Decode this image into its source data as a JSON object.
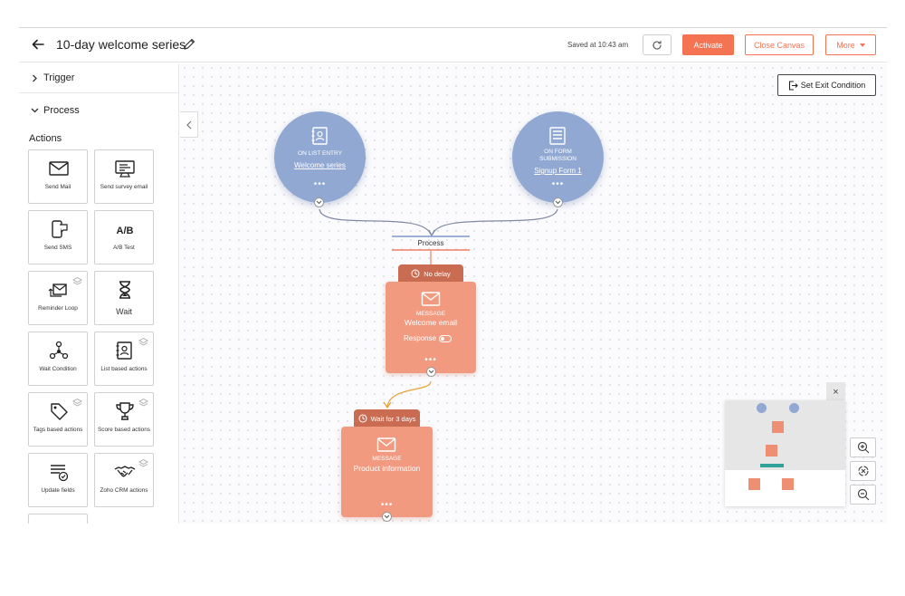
{
  "header": {
    "title": "10-day welcome series",
    "saved_text": "Saved at 10:43 am",
    "activate_label": "Activate",
    "close_canvas_label": "Close Canvas",
    "more_label": "More"
  },
  "sidebar": {
    "trigger_label": "Trigger",
    "process_label": "Process",
    "actions_title": "Actions",
    "actions": [
      {
        "label": "Send Mail",
        "icon": "mail-icon"
      },
      {
        "label": "Send survey email",
        "icon": "survey-icon"
      },
      {
        "label": "Send SMS",
        "icon": "sms-icon"
      },
      {
        "label": "A/B Test",
        "icon": "ab-test-icon"
      },
      {
        "label": "Reminder Loop",
        "icon": "reminder-loop-icon"
      },
      {
        "label": "Wait",
        "icon": "hourglass-icon"
      },
      {
        "label": "Wait Condition",
        "icon": "wait-condition-icon"
      },
      {
        "label": "List based actions",
        "icon": "list-actions-icon"
      },
      {
        "label": "Tags based actions",
        "icon": "tag-icon"
      },
      {
        "label": "Score based actions",
        "icon": "trophy-icon"
      },
      {
        "label": "Update fields",
        "icon": "update-fields-icon"
      },
      {
        "label": "Zoho CRM actions",
        "icon": "handshake-icon"
      }
    ]
  },
  "canvas": {
    "exit_label": "Set Exit Condition",
    "triggers": [
      {
        "type": "ON LIST ENTRY",
        "name": "Welcome series",
        "icon": "contact-book-icon"
      },
      {
        "type_line1": "ON FORM",
        "type_line2": "SUBMISSION",
        "name": "Signup Form 1",
        "icon": "form-icon"
      }
    ],
    "process_label": "Process",
    "steps": [
      {
        "delay": "No delay",
        "type": "MESSAGE",
        "name": "Welcome email",
        "response_label": "Response"
      },
      {
        "delay": "Wait for 3 days",
        "type": "MESSAGE",
        "name": "Product information"
      }
    ],
    "dots": "•••"
  },
  "minimap": {
    "close_glyph": "×"
  },
  "colors": {
    "accent": "#f47353",
    "trigger_node": "#91a8d3",
    "message_node": "#f29a80",
    "delay_tab": "#c96c52",
    "process_line_top": "#7e97c9",
    "process_line_bottom": "#f08062",
    "connector": "#e8a13a"
  }
}
